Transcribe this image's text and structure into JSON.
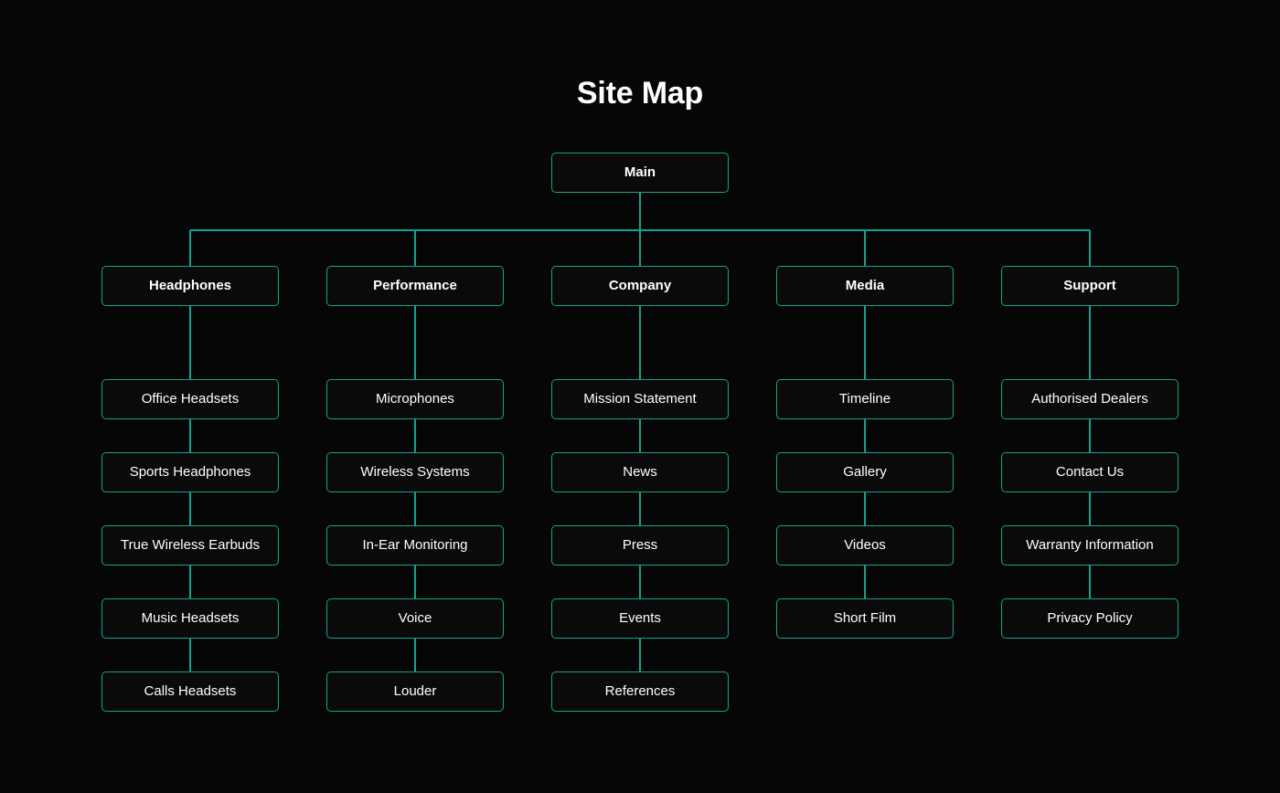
{
  "title": "Site Map",
  "theme": {
    "background": "#060606",
    "box_fill": "#0a0a0a",
    "accent": "#15a18f",
    "text": "#ffffff"
  },
  "root": {
    "label": "Main"
  },
  "columns": [
    {
      "branch": "Headphones",
      "children": [
        "Office Headsets",
        "Sports Headphones",
        "True Wireless Earbuds",
        "Music Headsets",
        "Calls Headsets"
      ]
    },
    {
      "branch": "Performance",
      "children": [
        "Microphones",
        "Wireless Systems",
        "In-Ear Monitoring",
        "Voice",
        "Louder"
      ]
    },
    {
      "branch": "Company",
      "children": [
        "Mission Statement",
        "News",
        "Press",
        "Events",
        "References"
      ]
    },
    {
      "branch": "Media",
      "children": [
        "Timeline",
        "Gallery",
        "Videos",
        "Short Film"
      ]
    },
    {
      "branch": "Support",
      "children": [
        "Authorised Dealers",
        "Contact Us",
        "Warranty Information",
        "Privacy Policy"
      ]
    }
  ]
}
